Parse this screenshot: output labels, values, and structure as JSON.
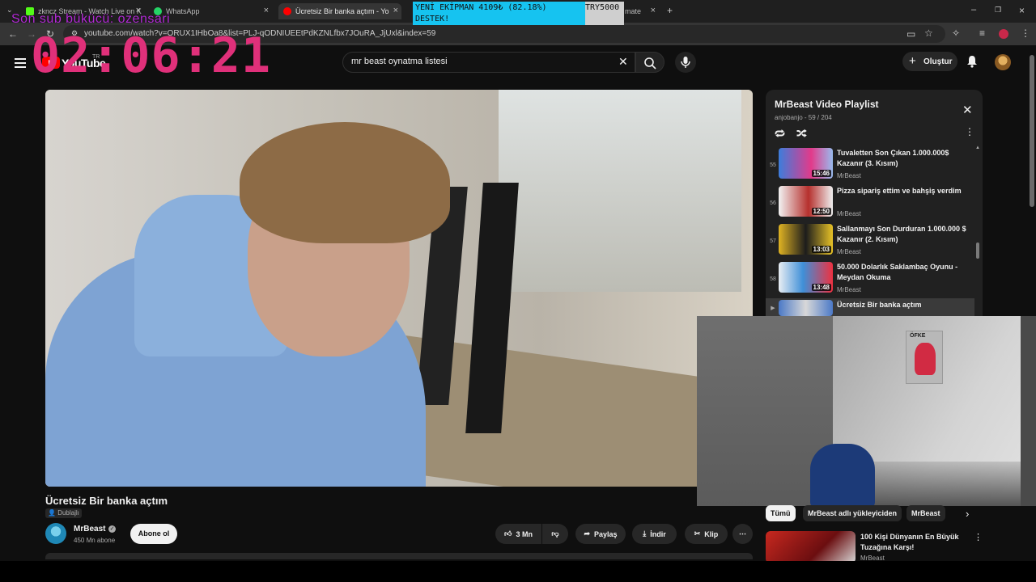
{
  "browser": {
    "tabs": [
      {
        "label": "zkncz Stream - Watch Live on K",
        "color": "#53fc18"
      },
      {
        "label": "WhatsApp",
        "color": "#25d366"
      },
      {
        "label": "Ücretsiz Bir banka açtım - Yo",
        "color": "#ff0000",
        "active": true
      },
      {
        "label": "mate",
        "color": "#888888"
      }
    ],
    "url": "youtube.com/watch?v=ORUX1IHbOa8&list=PLJ-qODNIUEEtPdKZNLfbx7JOuRA_JjUxl&index=59"
  },
  "overlay": {
    "donation_line1": "YENİ EKİPMAN 4109₺ (82.18%)",
    "donation_goal": "TRY5000",
    "donation_line2": "DESTEK!",
    "donation_progress_percent": 82.18,
    "last_sub": "Son sub bükücü: ozensari",
    "timer": "02:06:21"
  },
  "header": {
    "logo_text": "YouTube",
    "region": "TR",
    "search_query": "mr beast oynatma listesi",
    "create_label": "Oluştur"
  },
  "video": {
    "title": "Ücretsiz Bir banka açtım",
    "dub_label": "Dublajlı",
    "channel": "MrBeast",
    "subscribers": "450 Mn abone",
    "subscribe_label": "Abone ol",
    "likes": "3 Mn",
    "share_label": "Paylaş",
    "download_label": "İndir",
    "clip_label": "Klip"
  },
  "playlist": {
    "title": "MrBeast Video Playlist",
    "subtitle": "anjobanjo - 59 / 204",
    "items": [
      {
        "num": "55",
        "title": "Tuvaletten Son Çıkan 1.000.000$ Kazanır (3. Kısım)",
        "channel": "MrBeast",
        "duration": "15:46",
        "thumb": "#3d7ddb"
      },
      {
        "num": "56",
        "title": "Pizza sipariş ettim ve bahşiş verdim",
        "channel": "MrBeast",
        "duration": "12:50",
        "thumb": "#cfcfcf"
      },
      {
        "num": "57",
        "title": "Sallanmayı Son Durduran 1.000.000 $ Kazanır (2. Kısım)",
        "channel": "MrBeast",
        "duration": "13:03",
        "thumb": "#e0b323"
      },
      {
        "num": "58",
        "title": "50.000 Dolarlık Saklambaç Oyunu - Meydan Okuma",
        "channel": "MrBeast",
        "duration": "13:48",
        "thumb": "#3f8fd8"
      },
      {
        "num": "",
        "title": "Ücretsiz Bir banka açtım",
        "channel": "",
        "duration": "",
        "thumb": "#4b79c7",
        "active": true
      }
    ]
  },
  "chips": [
    "Tümü",
    "MrBeast adlı yükleyiciden",
    "MrBeast"
  ],
  "recommendation": {
    "title": "100 Kişi Dünyanın En Büyük Tuzağına Karşı!",
    "channel": "MrBeast"
  },
  "webcam": {
    "poster_caption": "ÖFKE"
  }
}
